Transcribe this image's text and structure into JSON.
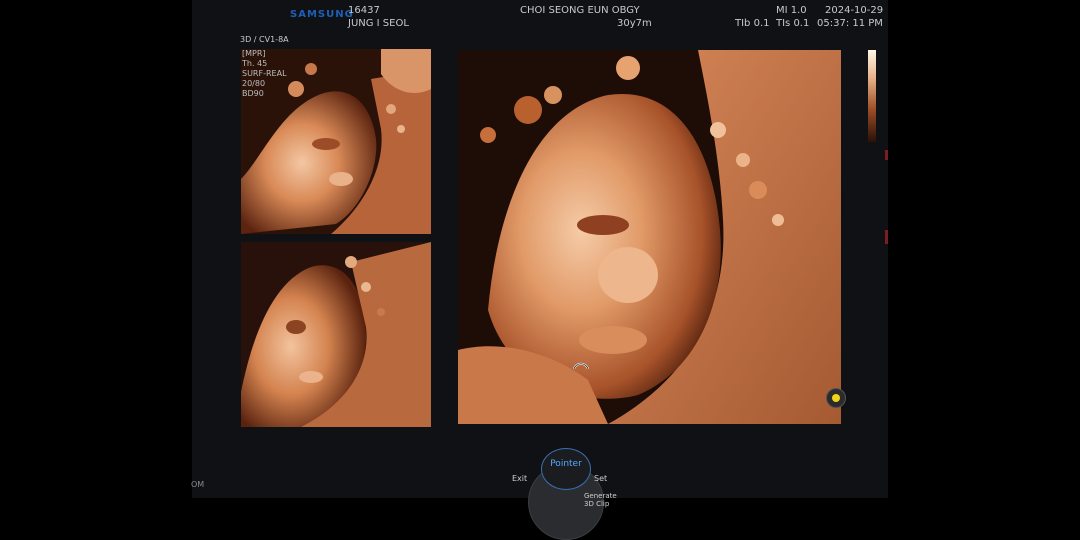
{
  "header": {
    "brand": "SAMSUNG",
    "patient_id": "16437",
    "patient_name": "JUNG I SEOL",
    "institution": "CHOI SEONG EUN OBGY",
    "gestational_age": "30y7m",
    "mi": "MI  1.0",
    "tib": "TIb 0.1",
    "tis": "TIs 0.1",
    "date": "2024-10-29",
    "time": "05:37: 11 PM"
  },
  "probe_label": "3D / CV1-8A",
  "side_params": [
    "[MPR]",
    "Th. 45",
    "SURF-REAL",
    "20/80",
    "BD90"
  ],
  "controls": {
    "pointer_label": "Pointer",
    "exit_label": "Exit",
    "set_label": "Set",
    "generate_label": "Generate 3D Clip"
  },
  "footer_mode": "OM",
  "colors": {
    "tissue_light": "#f0b78e",
    "tissue_mid": "#c96e3e",
    "tissue_dark": "#5a230f",
    "indicator": "#f2d21a",
    "pointer_accent": "#5aa7ff"
  }
}
